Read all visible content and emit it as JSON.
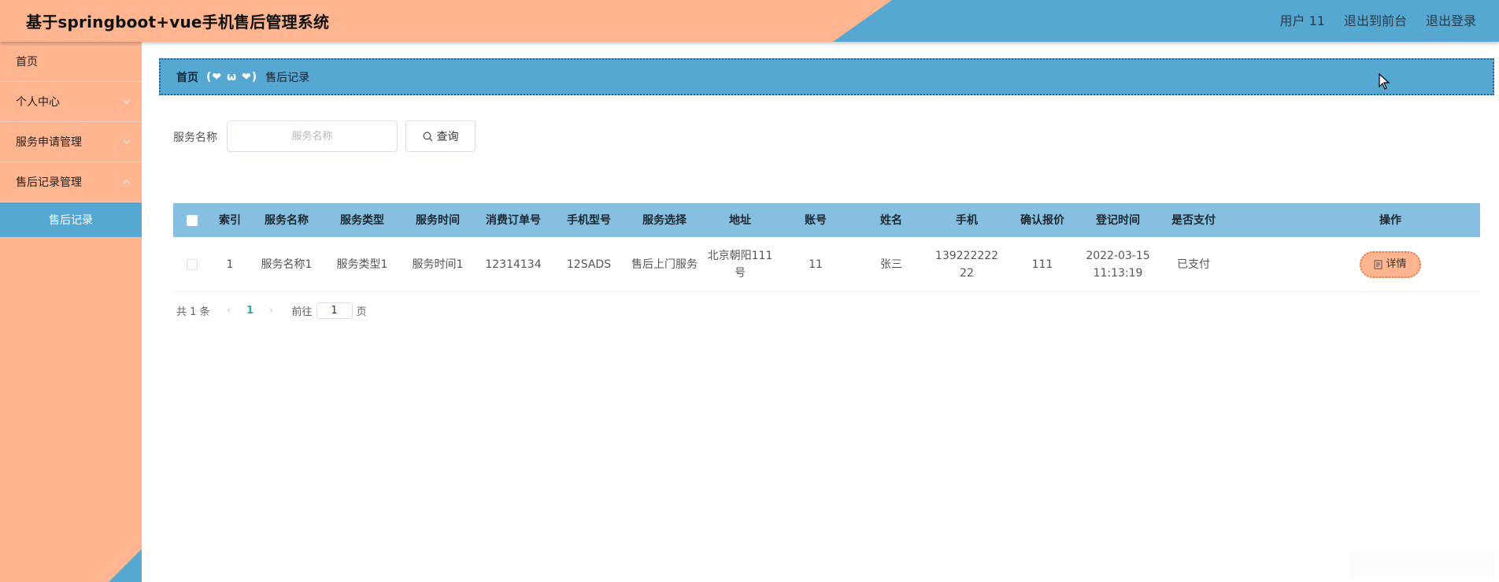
{
  "header": {
    "title": "基于springboot+vue手机售后管理系统",
    "user": "用户 11",
    "front_link": "退出到前台",
    "logout": "退出登录"
  },
  "sidebar": {
    "items": [
      {
        "label": "首页"
      },
      {
        "label": "个人中心"
      },
      {
        "label": "服务申请管理"
      },
      {
        "label": "售后记录管理"
      }
    ],
    "active_sub": "售后记录"
  },
  "breadcrumb": {
    "home": "首页",
    "separator": "(❤ ω ❤)",
    "current": "售后记录"
  },
  "search": {
    "label": "服务名称",
    "placeholder": "服务名称",
    "value": "",
    "button": "查询"
  },
  "table": {
    "headers": [
      "索引",
      "服务名称",
      "服务类型",
      "服务时间",
      "消费订单号",
      "手机型号",
      "服务选择",
      "地址",
      "账号",
      "姓名",
      "手机",
      "确认报价",
      "登记时间",
      "是否支付",
      "操作"
    ],
    "rows": [
      {
        "index": "1",
        "service_name": "服务名称1",
        "service_type": "服务类型1",
        "service_time": "服务时间1",
        "order_no": "12314134",
        "phone_model": "12SADS",
        "service_choice": "售后上门服务",
        "address": "北京朝阳111号",
        "account": "11",
        "name": "张三",
        "mobile": "13922222222",
        "quote": "111",
        "register_time": "2022-03-15 11:13:19",
        "paid": "已支付",
        "action": "详情"
      }
    ]
  },
  "pagination": {
    "total": "共 1 条",
    "current_page": "1",
    "goto_label": "前往",
    "goto_value": "1",
    "page_suffix": "页"
  },
  "colors": {
    "peach": "#ffb690",
    "blue": "#57a7d3",
    "table_header": "#86bfdf"
  }
}
